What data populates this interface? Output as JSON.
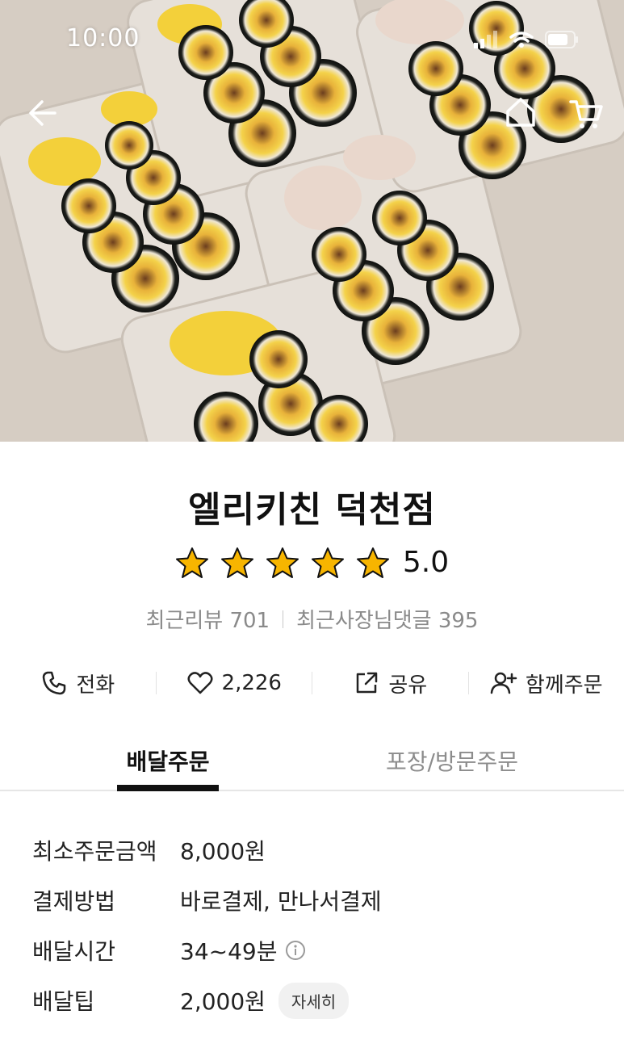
{
  "status_bar": {
    "time": "10:00"
  },
  "store": {
    "name": "엘리키친 덕천점",
    "rating": "5.0",
    "star_count": 5,
    "recent_reviews": "최근리뷰 701",
    "owner_replies": "최근사장님댓글 395"
  },
  "actions": {
    "call": "전화",
    "likes": "2,226",
    "share": "공유",
    "group_order": "함께주문"
  },
  "tabs": {
    "delivery": "배달주문",
    "pickup": "포장/방문주문"
  },
  "info": {
    "min_order_label": "최소주문금액",
    "min_order_value": "8,000원",
    "payment_label": "결제방법",
    "payment_value": "바로결제, 만나서결제",
    "delivery_time_label": "배달시간",
    "delivery_time_value": "34~49분",
    "delivery_tip_label": "배달팁",
    "delivery_tip_value": "2,000원",
    "detail_button": "자세히"
  },
  "colors": {
    "star": "#f7b500",
    "text": "#111111",
    "muted": "#8a8a8a"
  }
}
